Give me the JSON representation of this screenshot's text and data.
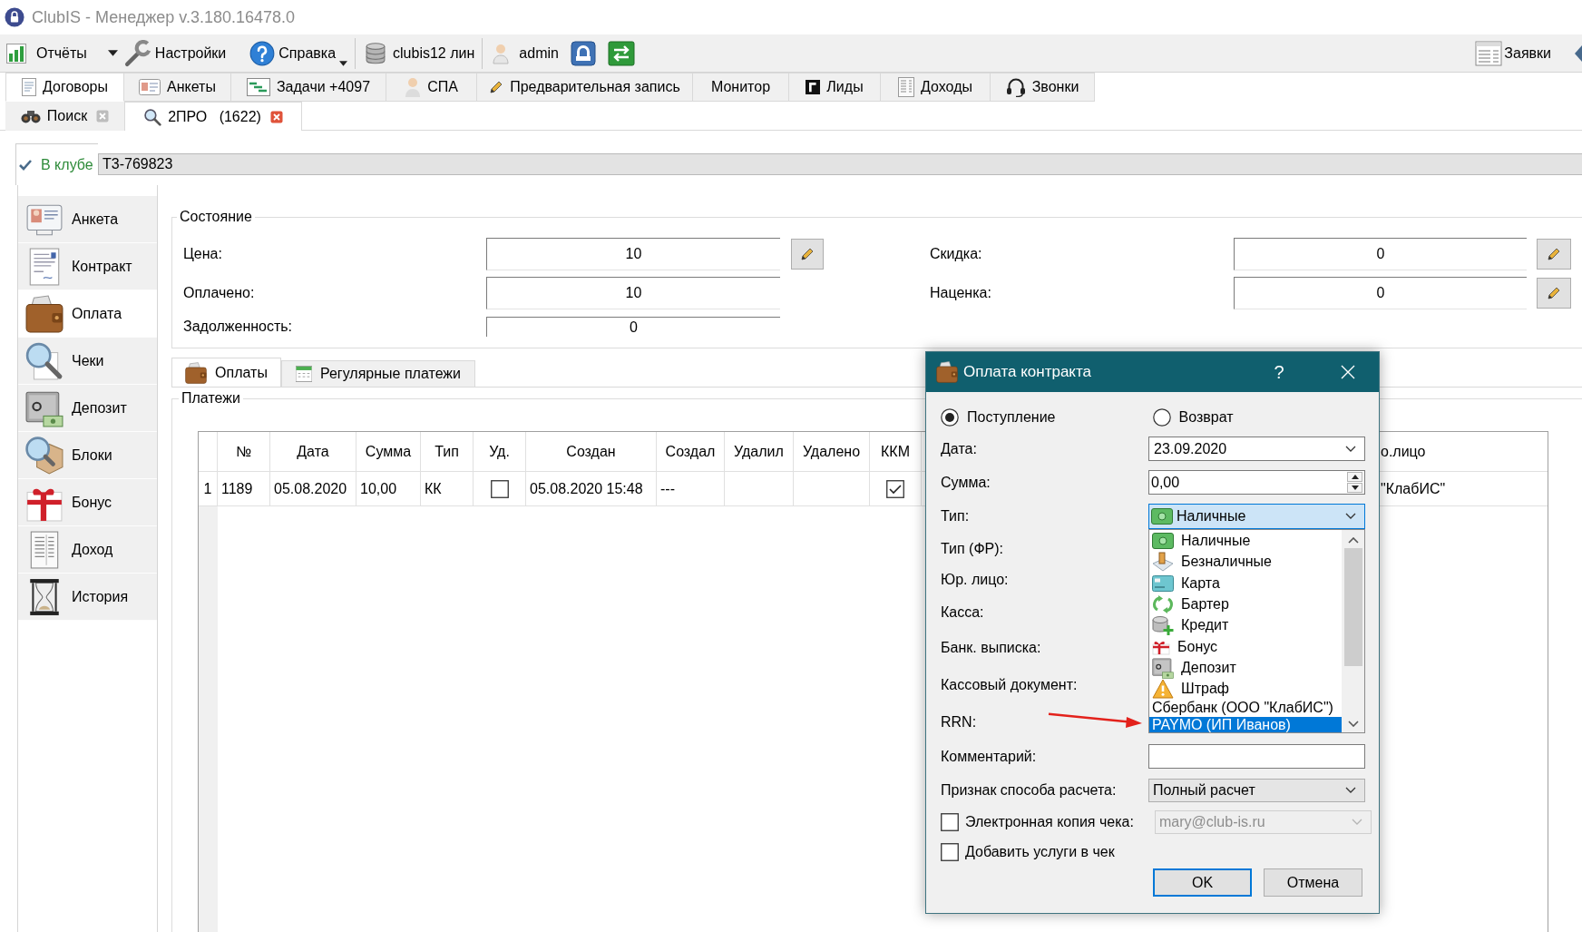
{
  "window": {
    "title": "ClubIS - Менеджер v.3.180.16478.0"
  },
  "toolbar": {
    "items": [
      {
        "label": "Отчёты"
      },
      {
        "label": "Настройки"
      },
      {
        "label": "Справка"
      },
      {
        "label": "clubis12 лин"
      },
      {
        "label": "admin"
      }
    ],
    "right_items": [
      {
        "label": "Заявки"
      }
    ]
  },
  "main_tabs": [
    {
      "label": "Договоры",
      "selected": true
    },
    {
      "label": "Анкеты",
      "selected": false
    },
    {
      "label": "Задачи +4097",
      "selected": false
    },
    {
      "label": "СПА",
      "selected": false
    },
    {
      "label": "Предварительная запись",
      "selected": false
    },
    {
      "label": "Монитор",
      "selected": false
    },
    {
      "label": "Лиды",
      "selected": false
    },
    {
      "label": "Доходы",
      "selected": false
    },
    {
      "label": "Звонки",
      "selected": false
    }
  ],
  "document_tabs": [
    {
      "label": "Поиск",
      "selected": false
    },
    {
      "label": "2ПРО   (1622)",
      "selected": true
    }
  ],
  "status": {
    "label": "В клубе",
    "value": "Т3-769823"
  },
  "sidebar": {
    "items": [
      {
        "label": "Анкета",
        "selected": false
      },
      {
        "label": "Контракт",
        "selected": false
      },
      {
        "label": "Оплата",
        "selected": true
      },
      {
        "label": "Чеки",
        "selected": false
      },
      {
        "label": "Депозит",
        "selected": false
      },
      {
        "label": "Блоки",
        "selected": false
      },
      {
        "label": "Бонус",
        "selected": false
      },
      {
        "label": "Доход",
        "selected": false
      },
      {
        "label": "История",
        "selected": false
      }
    ]
  },
  "state_group": {
    "title": "Состояние",
    "left_fields": [
      {
        "label": "Цена:",
        "value": "10",
        "kind": "editable"
      },
      {
        "label": "Оплачено:",
        "value": "10",
        "kind": "plain"
      },
      {
        "label": "Задолженность:",
        "value": "0",
        "kind": "flat"
      }
    ],
    "right_fields": [
      {
        "label": "Скидка:",
        "value": "0",
        "kind": "editable"
      },
      {
        "label": "Наценка:",
        "value": "0",
        "kind": "editable"
      }
    ]
  },
  "payment_tabs": [
    {
      "label": "Оплаты",
      "selected": true
    },
    {
      "label": "Регулярные платежи",
      "selected": false
    }
  ],
  "payments": {
    "title": "Платежи",
    "columns": [
      "№",
      "Дата",
      "Сумма",
      "Тип",
      "Уд.",
      "Создан",
      "Создал",
      "Удалил",
      "Удалено",
      "ККМ",
      "о.лицо"
    ],
    "rows": [
      {
        "number": "1",
        "cells": [
          {
            "kind": "text",
            "text": "1189"
          },
          {
            "kind": "text",
            "text": "05.08.2020"
          },
          {
            "kind": "text",
            "text": "10,00"
          },
          {
            "kind": "text",
            "text": "КК"
          },
          {
            "kind": "check",
            "checked": false
          },
          {
            "kind": "text",
            "text": "05.08.2020 15:48"
          },
          {
            "kind": "text",
            "text": "---"
          },
          {
            "kind": "blank"
          },
          {
            "kind": "blank"
          },
          {
            "kind": "check",
            "checked": true
          },
          {
            "kind": "text",
            "text": "\"КлабИС\""
          }
        ]
      }
    ]
  },
  "dialog": {
    "title": "Оплата контракта",
    "help": "?",
    "direction": [
      {
        "label": "Поступление",
        "selected": true
      },
      {
        "label": "Возврат",
        "selected": false
      }
    ],
    "rows": [
      {
        "label": "Дата:",
        "kind": "date",
        "value": "23.09.2020"
      },
      {
        "label": "Сумма:",
        "kind": "spin",
        "value": "0,00"
      },
      {
        "label": "Тип:",
        "kind": "type_select",
        "value": "Наличные",
        "expanded": true
      },
      {
        "label": "Тип (ФР):",
        "kind": "covered"
      },
      {
        "label": "Юр. лицо:",
        "kind": "covered"
      },
      {
        "label": "Касса:",
        "kind": "covered"
      },
      {
        "label": "Банк. выписка:",
        "kind": "covered"
      },
      {
        "label": "Кассовый документ:",
        "kind": "covered"
      },
      {
        "label": "RRN:",
        "kind": "covered"
      },
      {
        "label": "Комментарий:",
        "kind": "text"
      },
      {
        "label": "Признак способа расчета:",
        "kind": "select",
        "value": "Полный расчет",
        "expanded": false
      },
      {
        "label": "Электронная копия чека:",
        "kind": "check_select",
        "checked": false,
        "value": "mary@club-is.ru",
        "disabled": true
      },
      {
        "label": "Добавить услуги в чек",
        "kind": "check",
        "checked": false
      }
    ],
    "type_options": [
      {
        "label": "Наличные",
        "selected": false
      },
      {
        "label": "Безналичные",
        "selected": false
      },
      {
        "label": "Карта",
        "selected": false
      },
      {
        "label": "Бартер",
        "selected": false
      },
      {
        "label": "Кредит",
        "selected": false
      },
      {
        "label": "Бонус",
        "selected": false
      },
      {
        "label": "Депозит",
        "selected": false
      },
      {
        "label": "Штраф",
        "selected": false
      },
      {
        "label": "Сбербанк (ООО \"КлабИС\")",
        "selected": false
      },
      {
        "label": "PAYMO (ИП Иванов)",
        "selected": true
      }
    ],
    "buttons": [
      {
        "label": "OK",
        "default": true
      },
      {
        "label": "Отмена",
        "default": false
      }
    ]
  }
}
